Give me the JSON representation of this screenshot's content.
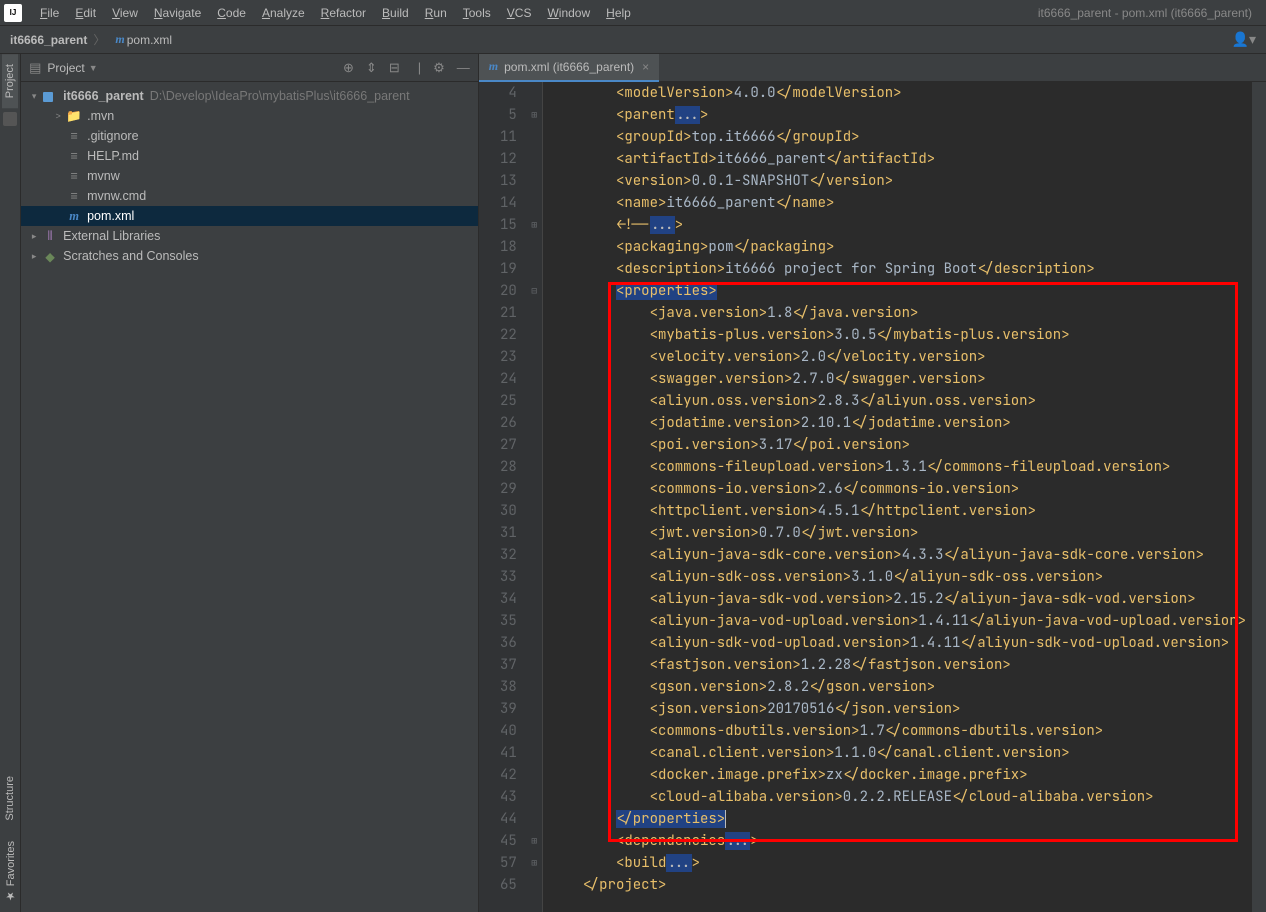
{
  "menubar": {
    "items": [
      "File",
      "Edit",
      "View",
      "Navigate",
      "Code",
      "Analyze",
      "Refactor",
      "Build",
      "Run",
      "Tools",
      "VCS",
      "Window",
      "Help"
    ],
    "title_right": "it6666_parent - pom.xml (it6666_parent)"
  },
  "breadcrumb": {
    "project": "it6666_parent",
    "file": "pom.xml"
  },
  "sidebar": {
    "header": "Project",
    "root": {
      "label": "it6666_parent",
      "path": "D:\\Develop\\IdeaPro\\mybatisPlus\\it6666_parent"
    },
    "children": [
      {
        "icon": "folder",
        "label": ".mvn",
        "arrow": ">"
      },
      {
        "icon": "file",
        "label": ".gitignore"
      },
      {
        "icon": "file",
        "label": "HELP.md"
      },
      {
        "icon": "file",
        "label": "mvnw"
      },
      {
        "icon": "file",
        "label": "mvnw.cmd"
      },
      {
        "icon": "m",
        "label": "pom.xml",
        "selected": true
      }
    ],
    "external": "External Libraries",
    "scratches": "Scratches and Consoles"
  },
  "left_gutter": {
    "labels": [
      "Project",
      "Structure",
      "Favorites"
    ]
  },
  "tab": {
    "label": "pom.xml (it6666_parent)"
  },
  "code": {
    "lines": [
      {
        "n": 4,
        "indent": 2,
        "tag": "modelVersion",
        "text": "4.0.0"
      },
      {
        "n": 5,
        "indent": 2,
        "raw": "<parent...>",
        "collapsed": true,
        "fold": "+"
      },
      {
        "n": 11,
        "indent": 2,
        "tag": "groupId",
        "text": "top.it6666"
      },
      {
        "n": 12,
        "indent": 2,
        "tag": "artifactId",
        "text": "it6666_parent"
      },
      {
        "n": 13,
        "indent": 2,
        "tag": "version",
        "text": "0.0.1-SNAPSHOT"
      },
      {
        "n": 14,
        "indent": 2,
        "tag": "name",
        "text": "it6666_parent"
      },
      {
        "n": 15,
        "indent": 2,
        "raw": "<!--...-->",
        "collapsed": true,
        "fold": "+"
      },
      {
        "n": 18,
        "indent": 2,
        "tag": "packaging",
        "text": "pom"
      },
      {
        "n": 19,
        "indent": 2,
        "tag": "description",
        "text": "it6666 project for Spring Boot"
      },
      {
        "n": 20,
        "indent": 2,
        "opentag": "properties",
        "hl": true,
        "fold": "-"
      },
      {
        "n": 21,
        "indent": 3,
        "tag": "java.version",
        "text": "1.8"
      },
      {
        "n": 22,
        "indent": 3,
        "tag": "mybatis-plus.version",
        "text": "3.0.5"
      },
      {
        "n": 23,
        "indent": 3,
        "tag": "velocity.version",
        "text": "2.0"
      },
      {
        "n": 24,
        "indent": 3,
        "tag": "swagger.version",
        "text": "2.7.0"
      },
      {
        "n": 25,
        "indent": 3,
        "tag": "aliyun.oss.version",
        "text": "2.8.3"
      },
      {
        "n": 26,
        "indent": 3,
        "tag": "jodatime.version",
        "text": "2.10.1"
      },
      {
        "n": 27,
        "indent": 3,
        "tag": "poi.version",
        "text": "3.17"
      },
      {
        "n": 28,
        "indent": 3,
        "tag": "commons-fileupload.version",
        "text": "1.3.1"
      },
      {
        "n": 29,
        "indent": 3,
        "tag": "commons-io.version",
        "text": "2.6"
      },
      {
        "n": 30,
        "indent": 3,
        "tag": "httpclient.version",
        "text": "4.5.1"
      },
      {
        "n": 31,
        "indent": 3,
        "tag": "jwt.version",
        "text": "0.7.0"
      },
      {
        "n": 32,
        "indent": 3,
        "tag": "aliyun-java-sdk-core.version",
        "text": "4.3.3"
      },
      {
        "n": 33,
        "indent": 3,
        "tag": "aliyun-sdk-oss.version",
        "text": "3.1.0"
      },
      {
        "n": 34,
        "indent": 3,
        "tag": "aliyun-java-sdk-vod.version",
        "text": "2.15.2"
      },
      {
        "n": 35,
        "indent": 3,
        "tag": "aliyun-java-vod-upload.version",
        "text": "1.4.11"
      },
      {
        "n": 36,
        "indent": 3,
        "tag": "aliyun-sdk-vod-upload.version",
        "text": "1.4.11"
      },
      {
        "n": 37,
        "indent": 3,
        "tag": "fastjson.version",
        "text": "1.2.28"
      },
      {
        "n": 38,
        "indent": 3,
        "tag": "gson.version",
        "text": "2.8.2"
      },
      {
        "n": 39,
        "indent": 3,
        "tag": "json.version",
        "text": "20170516"
      },
      {
        "n": 40,
        "indent": 3,
        "tag": "commons-dbutils.version",
        "text": "1.7"
      },
      {
        "n": 41,
        "indent": 3,
        "tag": "canal.client.version",
        "text": "1.1.0"
      },
      {
        "n": 42,
        "indent": 3,
        "tag": "docker.image.prefix",
        "text": "zx"
      },
      {
        "n": 43,
        "indent": 3,
        "tag": "cloud-alibaba.version",
        "text": "0.2.2.RELEASE"
      },
      {
        "n": 44,
        "indent": 2,
        "closetag": "properties",
        "hl": true,
        "cursor": true
      },
      {
        "n": 45,
        "indent": 2,
        "raw": "<dependencies...>",
        "collapsed": true,
        "fold": "+"
      },
      {
        "n": 57,
        "indent": 2,
        "raw": "<build...>",
        "collapsed": true,
        "fold": "+"
      },
      {
        "n": 65,
        "indent": 1,
        "closetag": "project"
      }
    ]
  }
}
